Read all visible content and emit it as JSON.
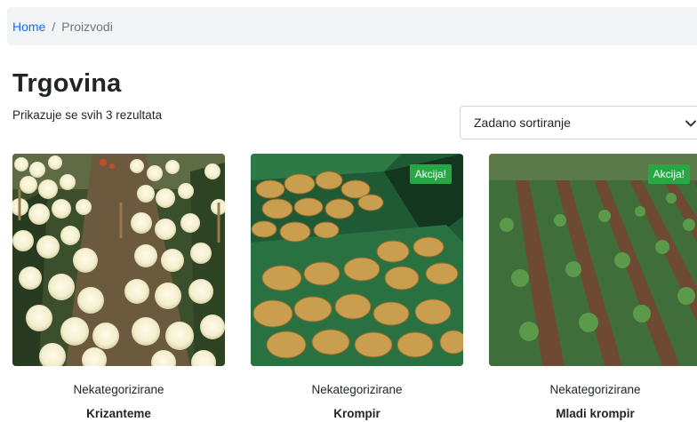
{
  "breadcrumb": {
    "home": "Home",
    "separator": "/",
    "current": "Proizvodi"
  },
  "page": {
    "title": "Trgovina",
    "result_count": "Prikazuje se svih 3 rezultata"
  },
  "sort": {
    "selected": "Zadano sortiranje"
  },
  "products": [
    {
      "category": "Nekategorizirane",
      "name": "Krizanteme",
      "badge": ""
    },
    {
      "category": "Nekategorizirane",
      "name": "Krompir",
      "badge": "Akcija!"
    },
    {
      "category": "Nekategorizirane",
      "name": "Mladi krompir",
      "badge": "Akcija!"
    }
  ],
  "colors": {
    "link": "#0d6efd",
    "badge": "#28a745",
    "breadcrumb_bg": "#f3f4f6"
  }
}
